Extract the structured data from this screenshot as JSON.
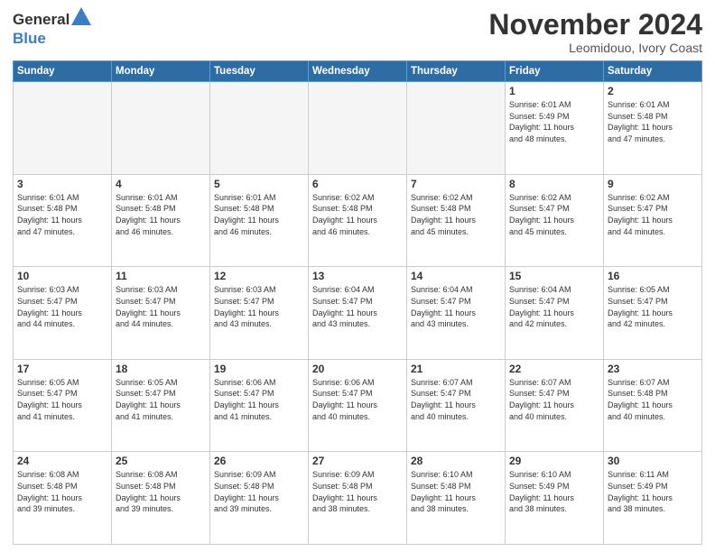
{
  "header": {
    "logo_general": "General",
    "logo_blue": "Blue",
    "month_title": "November 2024",
    "location": "Leomidouo, Ivory Coast"
  },
  "calendar": {
    "headers": [
      "Sunday",
      "Monday",
      "Tuesday",
      "Wednesday",
      "Thursday",
      "Friday",
      "Saturday"
    ],
    "weeks": [
      [
        {
          "day": "",
          "info": ""
        },
        {
          "day": "",
          "info": ""
        },
        {
          "day": "",
          "info": ""
        },
        {
          "day": "",
          "info": ""
        },
        {
          "day": "",
          "info": ""
        },
        {
          "day": "1",
          "info": "Sunrise: 6:01 AM\nSunset: 5:49 PM\nDaylight: 11 hours\nand 48 minutes."
        },
        {
          "day": "2",
          "info": "Sunrise: 6:01 AM\nSunset: 5:48 PM\nDaylight: 11 hours\nand 47 minutes."
        }
      ],
      [
        {
          "day": "3",
          "info": "Sunrise: 6:01 AM\nSunset: 5:48 PM\nDaylight: 11 hours\nand 47 minutes."
        },
        {
          "day": "4",
          "info": "Sunrise: 6:01 AM\nSunset: 5:48 PM\nDaylight: 11 hours\nand 46 minutes."
        },
        {
          "day": "5",
          "info": "Sunrise: 6:01 AM\nSunset: 5:48 PM\nDaylight: 11 hours\nand 46 minutes."
        },
        {
          "day": "6",
          "info": "Sunrise: 6:02 AM\nSunset: 5:48 PM\nDaylight: 11 hours\nand 46 minutes."
        },
        {
          "day": "7",
          "info": "Sunrise: 6:02 AM\nSunset: 5:48 PM\nDaylight: 11 hours\nand 45 minutes."
        },
        {
          "day": "8",
          "info": "Sunrise: 6:02 AM\nSunset: 5:47 PM\nDaylight: 11 hours\nand 45 minutes."
        },
        {
          "day": "9",
          "info": "Sunrise: 6:02 AM\nSunset: 5:47 PM\nDaylight: 11 hours\nand 44 minutes."
        }
      ],
      [
        {
          "day": "10",
          "info": "Sunrise: 6:03 AM\nSunset: 5:47 PM\nDaylight: 11 hours\nand 44 minutes."
        },
        {
          "day": "11",
          "info": "Sunrise: 6:03 AM\nSunset: 5:47 PM\nDaylight: 11 hours\nand 44 minutes."
        },
        {
          "day": "12",
          "info": "Sunrise: 6:03 AM\nSunset: 5:47 PM\nDaylight: 11 hours\nand 43 minutes."
        },
        {
          "day": "13",
          "info": "Sunrise: 6:04 AM\nSunset: 5:47 PM\nDaylight: 11 hours\nand 43 minutes."
        },
        {
          "day": "14",
          "info": "Sunrise: 6:04 AM\nSunset: 5:47 PM\nDaylight: 11 hours\nand 43 minutes."
        },
        {
          "day": "15",
          "info": "Sunrise: 6:04 AM\nSunset: 5:47 PM\nDaylight: 11 hours\nand 42 minutes."
        },
        {
          "day": "16",
          "info": "Sunrise: 6:05 AM\nSunset: 5:47 PM\nDaylight: 11 hours\nand 42 minutes."
        }
      ],
      [
        {
          "day": "17",
          "info": "Sunrise: 6:05 AM\nSunset: 5:47 PM\nDaylight: 11 hours\nand 41 minutes."
        },
        {
          "day": "18",
          "info": "Sunrise: 6:05 AM\nSunset: 5:47 PM\nDaylight: 11 hours\nand 41 minutes."
        },
        {
          "day": "19",
          "info": "Sunrise: 6:06 AM\nSunset: 5:47 PM\nDaylight: 11 hours\nand 41 minutes."
        },
        {
          "day": "20",
          "info": "Sunrise: 6:06 AM\nSunset: 5:47 PM\nDaylight: 11 hours\nand 40 minutes."
        },
        {
          "day": "21",
          "info": "Sunrise: 6:07 AM\nSunset: 5:47 PM\nDaylight: 11 hours\nand 40 minutes."
        },
        {
          "day": "22",
          "info": "Sunrise: 6:07 AM\nSunset: 5:47 PM\nDaylight: 11 hours\nand 40 minutes."
        },
        {
          "day": "23",
          "info": "Sunrise: 6:07 AM\nSunset: 5:48 PM\nDaylight: 11 hours\nand 40 minutes."
        }
      ],
      [
        {
          "day": "24",
          "info": "Sunrise: 6:08 AM\nSunset: 5:48 PM\nDaylight: 11 hours\nand 39 minutes."
        },
        {
          "day": "25",
          "info": "Sunrise: 6:08 AM\nSunset: 5:48 PM\nDaylight: 11 hours\nand 39 minutes."
        },
        {
          "day": "26",
          "info": "Sunrise: 6:09 AM\nSunset: 5:48 PM\nDaylight: 11 hours\nand 39 minutes."
        },
        {
          "day": "27",
          "info": "Sunrise: 6:09 AM\nSunset: 5:48 PM\nDaylight: 11 hours\nand 38 minutes."
        },
        {
          "day": "28",
          "info": "Sunrise: 6:10 AM\nSunset: 5:48 PM\nDaylight: 11 hours\nand 38 minutes."
        },
        {
          "day": "29",
          "info": "Sunrise: 6:10 AM\nSunset: 5:49 PM\nDaylight: 11 hours\nand 38 minutes."
        },
        {
          "day": "30",
          "info": "Sunrise: 6:11 AM\nSunset: 5:49 PM\nDaylight: 11 hours\nand 38 minutes."
        }
      ]
    ]
  }
}
